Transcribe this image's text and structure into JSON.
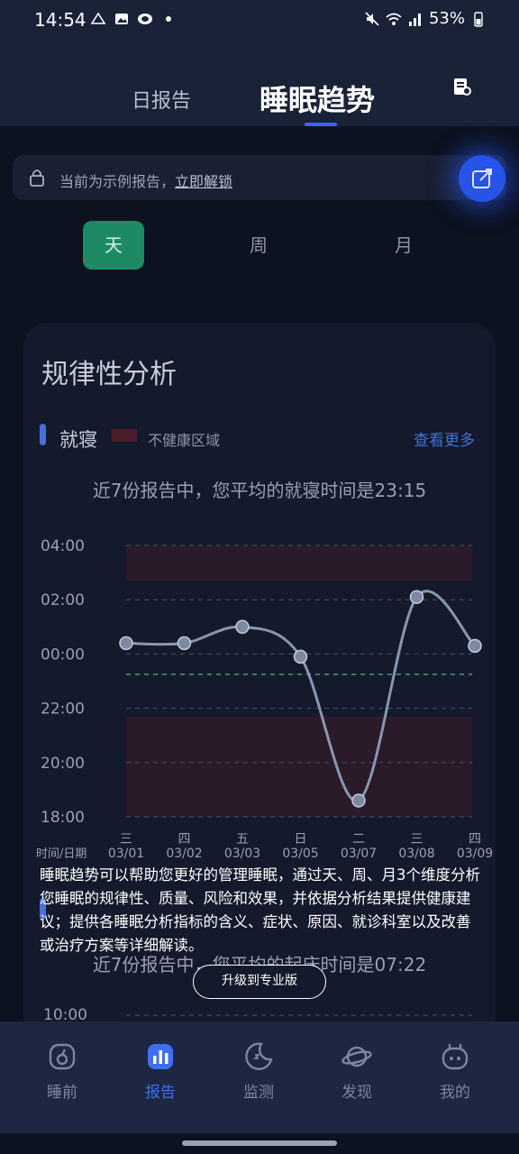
{
  "status_bar": {
    "time": "14:54",
    "battery": "53%"
  },
  "header": {
    "tab_daily": "日报告",
    "tab_trend": "睡眠趋势"
  },
  "lock_banner": {
    "text": "当前为示例报告，",
    "link": "立即解锁"
  },
  "segments": [
    "天",
    "周",
    "月"
  ],
  "card": {
    "title": "规律性分析",
    "legend_label": "就寝",
    "unhealthy_label": "不健康区域",
    "more": "查看更多",
    "avg_text": "近7份报告中，您平均的就寝时间是23:15",
    "axis_caption": "时间/日期"
  },
  "section2": {
    "avg_text": "近7份报告中，您平均的起床时间是07:22",
    "y_top": "10:00"
  },
  "overlay": {
    "text": "睡眠趋势可以帮助您更好的管理睡眠，通过天、周、月3个维度分析您睡眠的规律性、质量、风险和效果，并依据分析结果提供健康建议；提供各睡眠分析指标的含义、症状、原因、就诊科室以及改善或治疗方案等详细解读。",
    "upgrade": "升级到专业版"
  },
  "chart_data": {
    "type": "line",
    "yticks": [
      "04:00",
      "02:00",
      "00:00",
      "22:00",
      "20:00",
      "18:00"
    ],
    "categories": [
      {
        "weekday": "三",
        "date": "03/01"
      },
      {
        "weekday": "四",
        "date": "03/02"
      },
      {
        "weekday": "五",
        "date": "03/03"
      },
      {
        "weekday": "日",
        "date": "03/05"
      },
      {
        "weekday": "二",
        "date": "03/07"
      },
      {
        "weekday": "三",
        "date": "03/08"
      },
      {
        "weekday": "四",
        "date": "03/09"
      }
    ],
    "values_hours_after_1800": [
      6.4,
      6.4,
      7.0,
      5.9,
      0.6,
      8.1,
      6.3
    ],
    "unhealthy_ranges_hours_after_1800": [
      [
        8.7,
        10.0
      ],
      [
        0.0,
        3.7
      ]
    ],
    "ylim_hours_after_1800": [
      0,
      10
    ],
    "line_color": "#8a96b0"
  },
  "nav": [
    "睡前",
    "报告",
    "监测",
    "发现",
    "我的"
  ]
}
